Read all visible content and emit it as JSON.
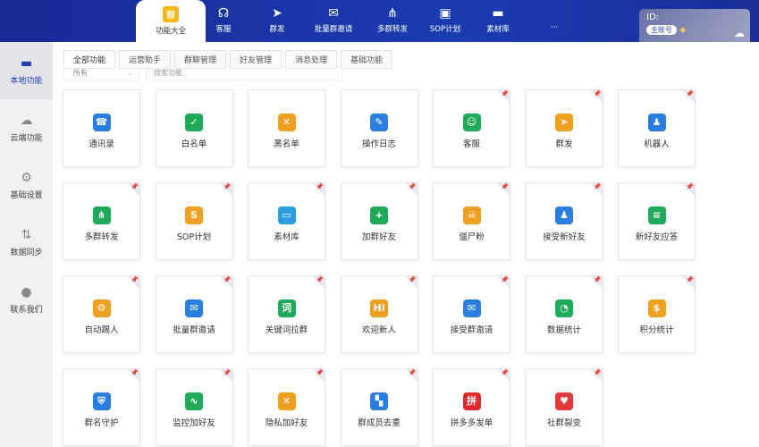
{
  "nav": [
    {
      "label": "功能大全",
      "icon": "apps-icon",
      "active": true
    },
    {
      "label": "客服",
      "icon": "headset-icon"
    },
    {
      "label": "群发",
      "icon": "send-icon"
    },
    {
      "label": "批量群邀请",
      "icon": "invite-icon"
    },
    {
      "label": "多群转发",
      "icon": "network-icon"
    },
    {
      "label": "SOP计划",
      "icon": "calendar-icon"
    },
    {
      "label": "素材库",
      "icon": "folder-icon"
    },
    {
      "label": "···",
      "icon": "more-icon"
    }
  ],
  "profile": {
    "id_label": "ID:",
    "badge": "主账号"
  },
  "sidebar": [
    {
      "label": "本地功能",
      "icon": "monitor-icon",
      "active": true
    },
    {
      "label": "云端功能",
      "icon": "cloud-icon"
    },
    {
      "label": "基础设置",
      "icon": "gear-icon"
    },
    {
      "label": "数据同步",
      "icon": "sync-icon"
    },
    {
      "label": "联系我们",
      "icon": "user-icon"
    }
  ],
  "tabs": [
    {
      "label": "全部功能",
      "active": true
    },
    {
      "label": "运营助手"
    },
    {
      "label": "群聊管理"
    },
    {
      "label": "好友管理"
    },
    {
      "label": "消息处理"
    },
    {
      "label": "基础功能"
    }
  ],
  "filter": {
    "select": "所有",
    "placeholder": "搜索功能"
  },
  "cards": [
    {
      "label": "通讯录",
      "color": "#2a7ee0",
      "glyph": "☎",
      "pin": false
    },
    {
      "label": "白名单",
      "color": "#1faa5a",
      "glyph": "✓",
      "pin": false
    },
    {
      "label": "黑名单",
      "color": "#f0a020",
      "glyph": "✕",
      "pin": false
    },
    {
      "label": "操作日志",
      "color": "#2a7ee0",
      "glyph": "✎",
      "pin": false
    },
    {
      "label": "客服",
      "color": "#1faa5a",
      "glyph": "☺",
      "pin": true
    },
    {
      "label": "群发",
      "color": "#f0a020",
      "glyph": "➤",
      "pin": true
    },
    {
      "label": "机器人",
      "color": "#2a7ee0",
      "glyph": "♟",
      "pin": true
    },
    {
      "label": "多群转发",
      "color": "#1faa5a",
      "glyph": "⋔",
      "pin": true
    },
    {
      "label": "SOP计划",
      "color": "#f0a020",
      "glyph": "S",
      "pin": true
    },
    {
      "label": "素材库",
      "color": "#2a9ee0",
      "glyph": "▭",
      "pin": true
    },
    {
      "label": "加群好友",
      "color": "#1faa5a",
      "glyph": "+",
      "pin": true
    },
    {
      "label": "僵尸粉",
      "color": "#f0a020",
      "glyph": "☠",
      "pin": true
    },
    {
      "label": "接受新好友",
      "color": "#2a7ee0",
      "glyph": "♟",
      "pin": true
    },
    {
      "label": "新好友应答",
      "color": "#1faa5a",
      "glyph": "≡",
      "pin": true
    },
    {
      "label": "自动踢人",
      "color": "#f0a020",
      "glyph": "⚙",
      "pin": true
    },
    {
      "label": "批量群邀请",
      "color": "#2a7ee0",
      "glyph": "✉",
      "pin": true
    },
    {
      "label": "关键词拉群",
      "color": "#1faa5a",
      "glyph": "词",
      "pin": true
    },
    {
      "label": "欢迎新人",
      "color": "#f0a020",
      "glyph": "Hi",
      "pin": true
    },
    {
      "label": "接受群邀请",
      "color": "#2a7ee0",
      "glyph": "✉",
      "pin": true
    },
    {
      "label": "数据统计",
      "color": "#1faa5a",
      "glyph": "◔",
      "pin": true
    },
    {
      "label": "积分统计",
      "color": "#f0a020",
      "glyph": "$",
      "pin": true
    },
    {
      "label": "群名守护",
      "color": "#2a7ee0",
      "glyph": "⛨",
      "pin": true
    },
    {
      "label": "监控加好友",
      "color": "#1faa5a",
      "glyph": "∿",
      "pin": true
    },
    {
      "label": "隐私加好友",
      "color": "#f0a020",
      "glyph": "✕",
      "pin": true
    },
    {
      "label": "群成员去重",
      "color": "#2a7ee0",
      "glyph": "▚",
      "pin": true
    },
    {
      "label": "拼多多发单",
      "color": "#e02a2a",
      "glyph": "拼",
      "pin": true
    },
    {
      "label": "社群裂变",
      "color": "#e03a3a",
      "glyph": "♥",
      "pin": true
    }
  ]
}
